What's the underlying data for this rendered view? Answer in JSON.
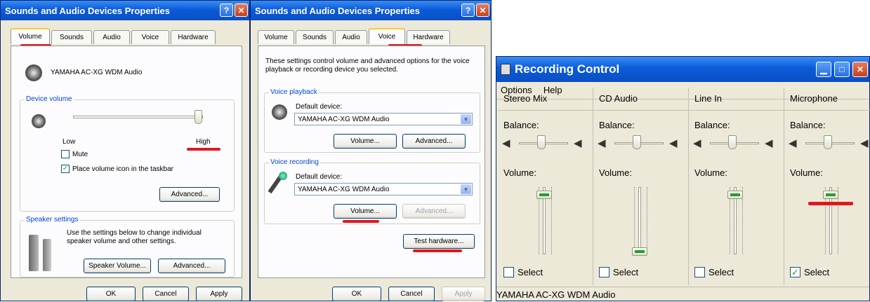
{
  "left_dialog": {
    "title": "Sounds and Audio Devices Properties",
    "tabs": [
      "Volume",
      "Sounds",
      "Audio",
      "Voice",
      "Hardware"
    ],
    "device_name": "YAMAHA AC-XG WDM Audio",
    "device_volume_label": "Device volume",
    "low_label": "Low",
    "high_label": "High",
    "device_volume_level": 1.0,
    "mute_label": "Mute",
    "mute_checked": false,
    "taskbar_label": "Place volume icon in the taskbar",
    "taskbar_checked": true,
    "advanced_label": "Advanced...",
    "speaker_settings_label": "Speaker settings",
    "speaker_desc": "Use the settings below to change individual speaker volume and other settings.",
    "speaker_volume_label": "Speaker Volume...",
    "speaker_advanced_label": "Advanced...",
    "ok": "OK",
    "cancel": "Cancel",
    "apply": "Apply"
  },
  "mid_dialog": {
    "title": "Sounds and Audio Devices Properties",
    "tabs": [
      "Volume",
      "Sounds",
      "Audio",
      "Voice",
      "Hardware"
    ],
    "description": "These settings control volume and advanced options for the voice playback or recording device you selected.",
    "playback_label": "Voice playback",
    "playback_default": "Default device:",
    "playback_device": "YAMAHA AC-XG WDM Audio",
    "playback_volume": "Volume...",
    "playback_advanced": "Advanced...",
    "recording_label": "Voice recording",
    "recording_default": "Default device:",
    "recording_device": "YAMAHA AC-XG WDM Audio",
    "recording_volume": "Volume...",
    "recording_advanced": "Advanced...",
    "test_hardware": "Test hardware...",
    "ok": "OK",
    "cancel": "Cancel",
    "apply": "Apply"
  },
  "recording_control": {
    "title": "Recording Control",
    "menu": [
      "Options",
      "Help"
    ],
    "balance_label": "Balance:",
    "volume_label": "Volume:",
    "select_label": "Select",
    "columns": [
      {
        "name": "Stereo Mix",
        "volume": 0.9,
        "selected": false
      },
      {
        "name": "CD Audio",
        "volume": 0.0,
        "selected": false
      },
      {
        "name": "Line In",
        "volume": 0.9,
        "selected": false
      },
      {
        "name": "Microphone",
        "volume": 0.9,
        "selected": true
      }
    ],
    "status": "YAMAHA AC-XG WDM Audio"
  },
  "colors": {
    "accent_red": "#e4161d",
    "xp_blue": "#0b5bd8",
    "dialog_bg": "#ece9d8"
  }
}
